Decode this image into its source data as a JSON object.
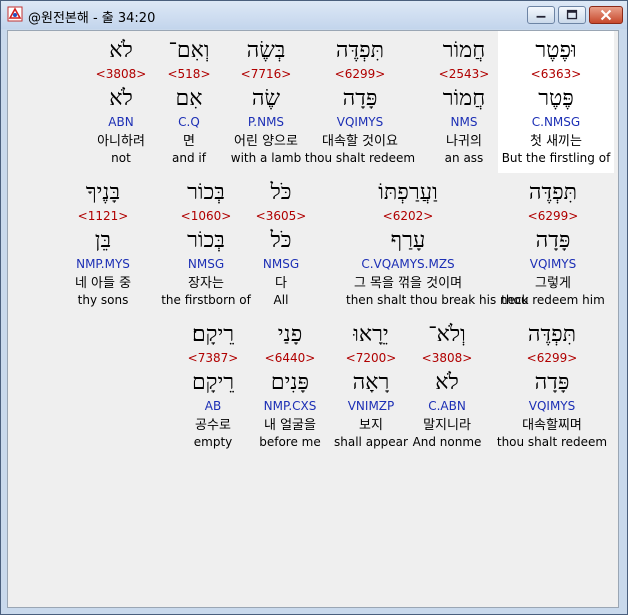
{
  "window": {
    "title": "@원전본해 - 출 34:20",
    "icon": "app-logo-icon",
    "controls": [
      "minimize-icon",
      "maximize-icon",
      "close-icon"
    ]
  },
  "rows": [
    {
      "words": [
        {
          "hebrew": "וּפֶטֶר",
          "strong": "<6363>",
          "lemma": "פֶּטֶר",
          "morph": "C.NMSG",
          "korean": "첫 새끼는",
          "english": "But the firstling of"
        },
        {
          "hebrew": "חֲמוֹר",
          "strong": "<2543>",
          "lemma": "חֲמוֹר",
          "morph": "NMS",
          "korean": "나귀의",
          "english": "an ass"
        },
        {
          "hebrew": "תִּפְדֶּה",
          "strong": "<6299>",
          "lemma": "פָּדָה",
          "morph": "VQIMYS",
          "korean": "대속할 것이요",
          "english": "thou shalt redeem"
        },
        {
          "hebrew": "בְּשֶׂה",
          "strong": "<7716>",
          "lemma": "שֶׂה",
          "morph": "P.NMS",
          "korean": "어린 양으로",
          "english": "with a lamb"
        },
        {
          "hebrew": "וְאִם־",
          "strong": "<518>",
          "lemma": "אִם",
          "morph": "C.Q",
          "korean": "면",
          "english": "and if"
        },
        {
          "hebrew": "לֹא",
          "strong": "<3808>",
          "lemma": "לֹא",
          "morph": "ABN",
          "korean": "아니하려",
          "english": "not"
        }
      ]
    },
    {
      "words": [
        {
          "hebrew": "תִּפְדֶּה",
          "strong": "<6299>",
          "lemma": "פָּדָה",
          "morph": "VQIMYS",
          "korean": "그렇게",
          "english": "thou redeem him"
        },
        {
          "hebrew": "וַעֲרַפְתּוֹ",
          "strong": "<6202>",
          "lemma": "עָרַף",
          "morph": "C.VQAMYS.MZS",
          "korean": "그 목을 꺾을 것이며",
          "english": "then shalt thou break his neck"
        },
        {
          "hebrew": "כֹּל",
          "strong": "<3605>",
          "lemma": "כֹּל",
          "morph": "NMSG",
          "korean": "다",
          "english": "All"
        },
        {
          "hebrew": "בְּכוֹר",
          "strong": "<1060>",
          "lemma": "בְּכוֹר",
          "morph": "NMSG",
          "korean": "장자는",
          "english": "the firstborn of"
        },
        {
          "hebrew": "בָּנֶיךָ",
          "strong": "<1121>",
          "lemma": "בֵּן",
          "morph": "NMP.MYS",
          "korean": "네 아들 중",
          "english": "thy sons"
        }
      ]
    },
    {
      "words": [
        {
          "hebrew": "תִּפְדֶּה",
          "strong": "<6299>",
          "lemma": "פָּדָה",
          "morph": "VQIMYS",
          "korean": "대속할찌며",
          "english": "thou shalt redeem"
        },
        {
          "hebrew": "וְלֹא־",
          "strong": "<3808>",
          "lemma": "לֹא",
          "morph": "C.ABN",
          "korean": "말지니라",
          "english": "And nonme"
        },
        {
          "hebrew": "יֵרָאוּ",
          "strong": "<7200>",
          "lemma": "רָאָה",
          "morph": "VNIMZP",
          "korean": "보지",
          "english": "shall appear"
        },
        {
          "hebrew": "פָנַי",
          "strong": "<6440>",
          "lemma": "פָּנִים",
          "morph": "NMP.CXS",
          "korean": "내 얼굴을",
          "english": "before me"
        },
        {
          "hebrew": "רֵיקָם׃",
          "strong": "<7387>",
          "lemma": "רֵיקָם",
          "morph": "AB",
          "korean": "공수로",
          "english": "empty"
        }
      ]
    }
  ],
  "colors": {
    "strong": "#b00000",
    "morph": "#1c2fb5",
    "highlight": "#ffffff",
    "background": "#efefef"
  }
}
